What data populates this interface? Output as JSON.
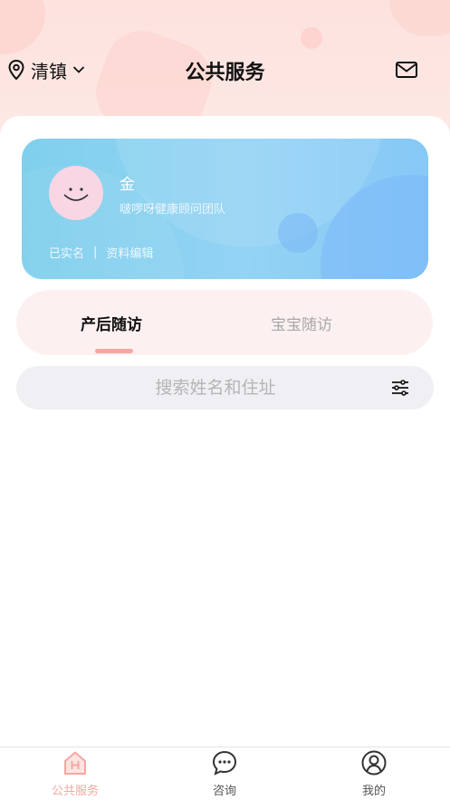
{
  "header": {
    "location": "清镇",
    "title": "公共服务"
  },
  "profile": {
    "name": "金",
    "team": "啵啰呀健康顾问团队",
    "verified": "已实名",
    "separator": "|",
    "edit": "资料编辑"
  },
  "tabs": [
    {
      "label": "产后随访",
      "active": true
    },
    {
      "label": "宝宝随访",
      "active": false
    }
  ],
  "search": {
    "placeholder": "搜索姓名和住址"
  },
  "bottom_nav": [
    {
      "label": "公共服务",
      "icon": "home-icon",
      "active": true
    },
    {
      "label": "咨询",
      "icon": "chat-icon",
      "active": false
    },
    {
      "label": "我的",
      "icon": "user-icon",
      "active": false
    }
  ],
  "colors": {
    "accent": "#f4a7a2",
    "card_gradient_start": "#7fd0ec",
    "card_gradient_end": "#86c8f6",
    "header_bg": "#fde2de"
  }
}
